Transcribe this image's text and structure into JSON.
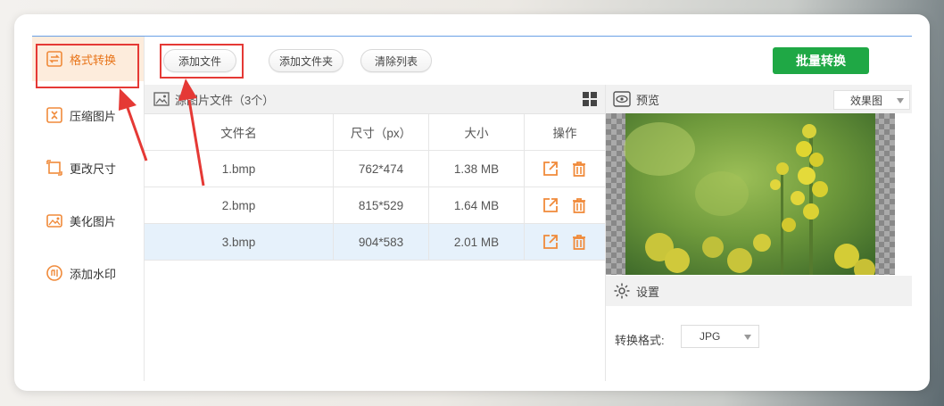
{
  "sidebar": {
    "items": [
      {
        "label": "格式转换",
        "icon": "convert-icon",
        "active": true
      },
      {
        "label": "压缩图片",
        "icon": "compress-icon",
        "active": false
      },
      {
        "label": "更改尺寸",
        "icon": "resize-icon",
        "active": false
      },
      {
        "label": "美化图片",
        "icon": "beautify-icon",
        "active": false
      },
      {
        "label": "添加水印",
        "icon": "watermark-icon",
        "active": false
      }
    ]
  },
  "toolbar": {
    "add_file": "添加文件",
    "add_folder": "添加文件夹",
    "clear_list": "清除列表",
    "batch_convert": "批量转换"
  },
  "file_panel": {
    "title": "源图片文件（3个）",
    "columns": [
      "文件名",
      "尺寸（px）",
      "大小",
      "操作"
    ],
    "rows": [
      {
        "name": "1.bmp",
        "size_px": "762*474",
        "filesize": "1.38 MB",
        "selected": false
      },
      {
        "name": "2.bmp",
        "size_px": "815*529",
        "filesize": "1.64 MB",
        "selected": false
      },
      {
        "name": "3.bmp",
        "size_px": "904*583",
        "filesize": "2.01 MB",
        "selected": true
      }
    ]
  },
  "preview": {
    "title": "预览",
    "mode_selected": "效果图"
  },
  "settings": {
    "title": "设置",
    "format_label": "转换格式:",
    "format_selected": "JPG"
  },
  "colors": {
    "accent_orange": "#e8751a",
    "batch_green": "#1fa845",
    "highlight_red": "#e53935",
    "selected_row": "#e6f1fb"
  }
}
